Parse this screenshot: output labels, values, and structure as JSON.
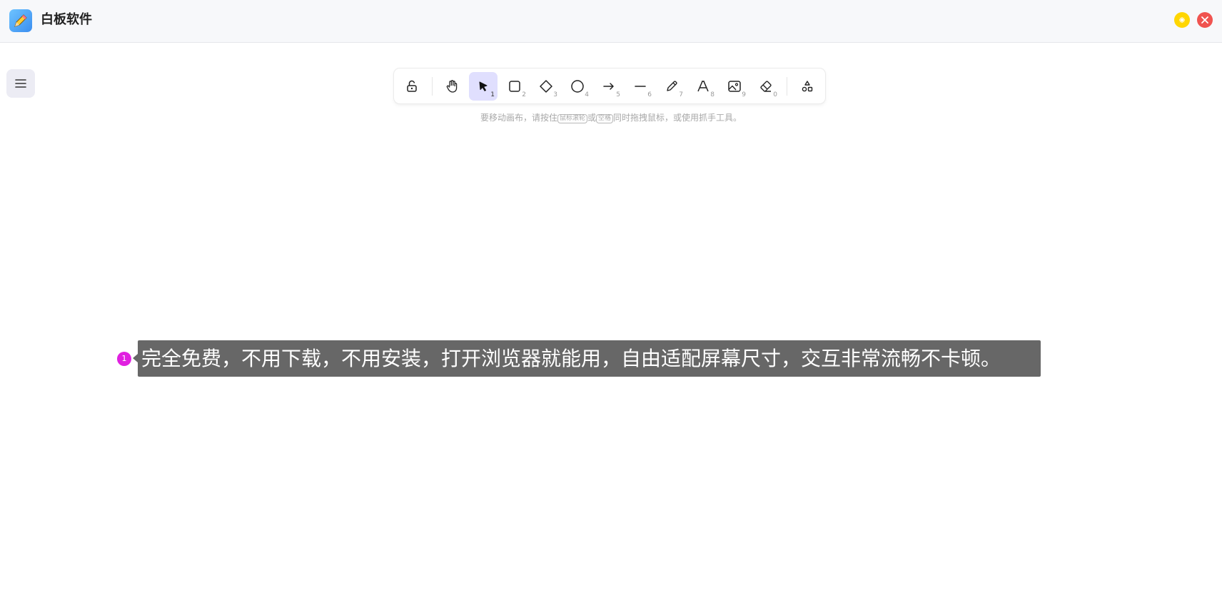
{
  "app": {
    "title": "白板软件",
    "icon": "pencil-app-icon",
    "window_controls": {
      "minimize": "minimize-icon",
      "close": "close-icon"
    }
  },
  "menu": {
    "icon": "hamburger-menu-icon"
  },
  "toolbar": {
    "tools": [
      {
        "name": "lock",
        "icon": "unlock-icon",
        "key": ""
      },
      {
        "name": "hand",
        "icon": "hand-icon",
        "key": ""
      },
      {
        "name": "select",
        "icon": "cursor-icon",
        "key": "1",
        "active": true
      },
      {
        "name": "rectangle",
        "icon": "rectangle-icon",
        "key": "2"
      },
      {
        "name": "diamond",
        "icon": "diamond-icon",
        "key": "3"
      },
      {
        "name": "ellipse",
        "icon": "ellipse-icon",
        "key": "4"
      },
      {
        "name": "arrow",
        "icon": "arrow-icon",
        "key": "5"
      },
      {
        "name": "line",
        "icon": "line-icon",
        "key": "6"
      },
      {
        "name": "pencil",
        "icon": "pencil-icon",
        "key": "7"
      },
      {
        "name": "text",
        "icon": "text-icon",
        "key": "8"
      },
      {
        "name": "image",
        "icon": "image-icon",
        "key": "9"
      },
      {
        "name": "eraser",
        "icon": "eraser-icon",
        "key": "0"
      },
      {
        "name": "shapes",
        "icon": "shapes-icon",
        "key": ""
      }
    ]
  },
  "hint": {
    "part1": "要移动画布，请按住",
    "kbd1": "鼠标滚轮",
    "part2": "或",
    "kbd2": "空格",
    "part3": "同时拖拽鼠标，或使用抓手工具。"
  },
  "caption": {
    "marker": "1",
    "text": "完全免费，不用下载，不用安装，打开浏览器就能用，自由适配屏幕尺寸，交互非常流畅不卡顿。"
  },
  "colors": {
    "accent_active_tool": "#e0dffe",
    "marker": "#e020e0",
    "caption_bg": "#676767",
    "minimize": "#ffd600",
    "close": "#f0534f"
  }
}
